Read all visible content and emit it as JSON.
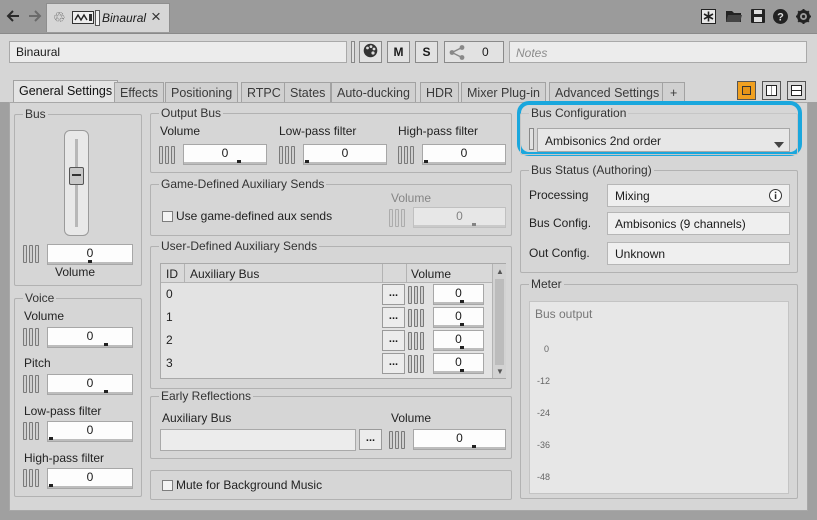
{
  "titlebar": {
    "tab_title": "Binaural",
    "icons": [
      "back-arrow-icon",
      "forward-arrow-icon",
      "recycle-icon",
      "audio-bus-icon",
      "close-icon",
      "star-search-icon",
      "folder-icon",
      "save-icon",
      "help-icon",
      "settings-icon"
    ]
  },
  "header": {
    "name_value": "Binaural",
    "m_label": "M",
    "s_label": "S",
    "references_count": "0",
    "notes_placeholder": "Notes"
  },
  "tabs": [
    {
      "label": "General Settings"
    },
    {
      "label": "Effects"
    },
    {
      "label": "Positioning"
    },
    {
      "label": "RTPC"
    },
    {
      "label": "States"
    },
    {
      "label": "Auto-ducking"
    },
    {
      "label": "HDR"
    },
    {
      "label": "Mixer Plug-in"
    },
    {
      "label": "Advanced Settings"
    },
    {
      "label": "+"
    }
  ],
  "bus": {
    "title": "Bus",
    "volume_value": "0",
    "volume_label": "Volume"
  },
  "voice": {
    "title": "Voice",
    "volume_label": "Volume",
    "volume_value": "0",
    "pitch_label": "Pitch",
    "pitch_value": "0",
    "lpf_label": "Low-pass filter",
    "lpf_value": "0",
    "hpf_label": "High-pass filter",
    "hpf_value": "0"
  },
  "output_bus": {
    "title": "Output Bus",
    "volume_label": "Volume",
    "volume_value": "0",
    "lpf_label": "Low-pass filter",
    "lpf_value": "0",
    "hpf_label": "High-pass filter",
    "hpf_value": "0"
  },
  "game_aux": {
    "title": "Game-Defined Auxiliary Sends",
    "checkbox_label": "Use game-defined aux sends",
    "volume_label": "Volume",
    "volume_value": "0"
  },
  "user_aux": {
    "title": "User-Defined Auxiliary Sends",
    "columns": [
      "ID",
      "Auxiliary Bus",
      "Volume"
    ],
    "rows": [
      {
        "id": "0",
        "bus": "",
        "volume": "0"
      },
      {
        "id": "1",
        "bus": "",
        "volume": "0"
      },
      {
        "id": "2",
        "bus": "",
        "volume": "0"
      },
      {
        "id": "3",
        "bus": "",
        "volume": "0"
      }
    ],
    "browse_label": "..."
  },
  "early_reflections": {
    "title": "Early Reflections",
    "aux_label": "Auxiliary Bus",
    "volume_label": "Volume",
    "volume_value": "0",
    "browse_label": "..."
  },
  "mute_bg": {
    "label": "Mute for Background Music"
  },
  "bus_config": {
    "title": "Bus Configuration",
    "selected": "Ambisonics 2nd order"
  },
  "bus_status": {
    "title": "Bus Status (Authoring)",
    "processing_label": "Processing",
    "processing_value": "Mixing",
    "config_label": "Bus Config.",
    "config_value": "Ambisonics (9 channels)",
    "out_label": "Out Config.",
    "out_value": "Unknown"
  },
  "meter": {
    "title": "Meter",
    "caption": "Bus output",
    "ticks": [
      "0",
      "-12",
      "-24",
      "-36",
      "-48"
    ]
  },
  "colors": {
    "highlight": "#1aa7dd",
    "panel": "#d6d6d6",
    "titlebar": "#9b9b9b"
  }
}
